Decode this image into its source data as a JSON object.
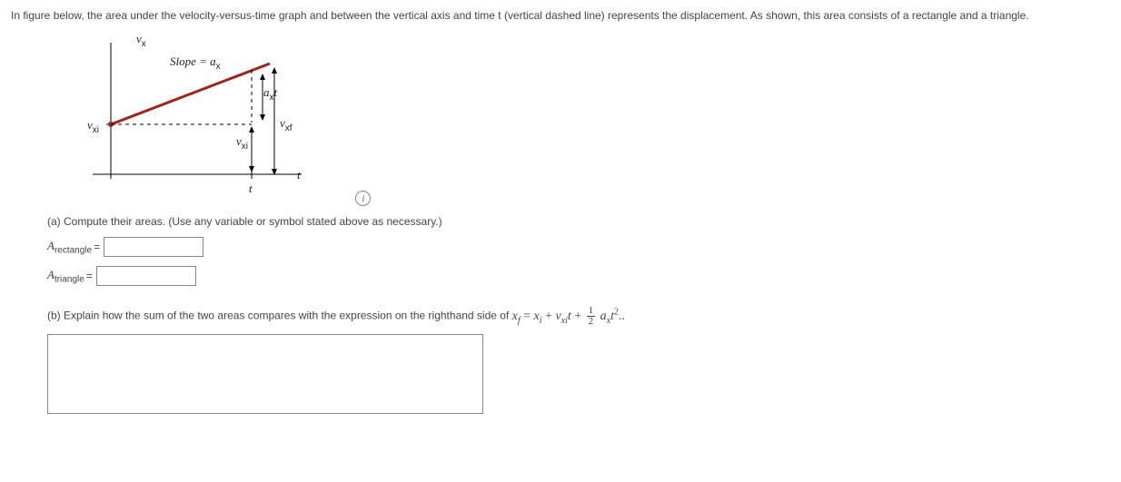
{
  "intro": "In figure below, the area under the velocity-versus-time graph and between the vertical axis and time t (vertical dashed line) represents the displacement. As shown, this area consists of a rectangle and a triangle.",
  "figure": {
    "y_axis": "v",
    "y_axis_sub": "x",
    "x_axis": "t",
    "slope_label": "Slope  =  a",
    "slope_sub": "x",
    "left_label": "v",
    "left_label_sub": "xi",
    "right_upper": "a",
    "right_upper_sub": "x",
    "right_upper_tail": "t",
    "right_mid": "v",
    "right_mid_sub": "xf",
    "right_lower": "v",
    "right_lower_sub": "xi",
    "bottom_label": "t",
    "info_tooltip": "i"
  },
  "partA": {
    "prompt": "(a) Compute their areas. (Use any variable or symbol stated above as necessary.)",
    "rect_label": "A",
    "rect_sub": "rectangle",
    "tri_label": "A",
    "tri_sub": "triangle",
    "equals": "=",
    "rect_value": "",
    "tri_value": ""
  },
  "partB": {
    "prompt_prefix": "(b) Explain how the sum of the two areas compares with the expression on the righthand side of ",
    "eq": {
      "xf": "x",
      "xf_sub": "f",
      "xi": "x",
      "xi_sub": "i",
      "vxi": "v",
      "vxi_sub": "xi",
      "t1": "t",
      "frac_num": "1",
      "frac_den": "2",
      "ax": "a",
      "ax_sub": "x",
      "t2": "t",
      "sq": "2",
      "tail": ".."
    },
    "value": ""
  }
}
